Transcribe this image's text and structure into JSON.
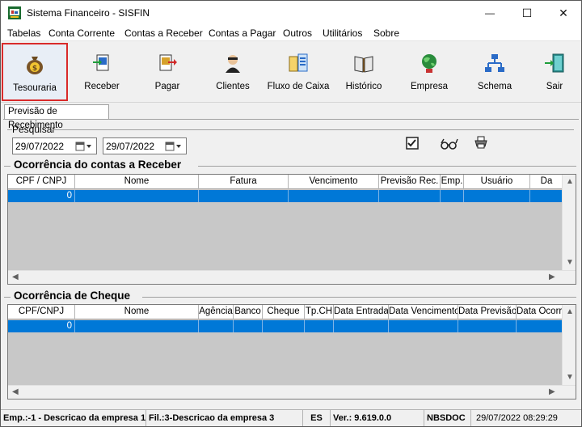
{
  "window": {
    "title": "Sistema Financeiro - SISFIN",
    "controls": {
      "minimize": "—",
      "maximize": "☐",
      "close": "✕"
    }
  },
  "menu": [
    "Tabelas",
    "Conta Corrente",
    "Contas a Receber",
    "Contas a Pagar",
    "Outros",
    "Utilitários",
    "Sobre"
  ],
  "toolbar": {
    "buttons": [
      {
        "label": "Tesouraria",
        "icon": "money-bag-icon",
        "active": true
      },
      {
        "label": "Receber",
        "icon": "receive-document-icon",
        "active": false
      },
      {
        "label": "Pagar",
        "icon": "pay-document-icon",
        "active": false
      },
      {
        "label": "Clientes",
        "icon": "clients-icon",
        "active": false
      },
      {
        "label": "Fluxo de Caixa",
        "icon": "cash-flow-icon",
        "active": false
      },
      {
        "label": "Histórico",
        "icon": "book-icon",
        "active": false
      },
      {
        "label": "Empresa",
        "icon": "company-globe-icon",
        "active": false
      },
      {
        "label": "Schema",
        "icon": "network-schema-icon",
        "active": false
      },
      {
        "label": "Sair",
        "icon": "exit-door-icon",
        "active": false
      }
    ]
  },
  "tab": {
    "label": "Previsão de Recebimento"
  },
  "filter": {
    "group_label": "Pesquisar",
    "date_from": "29/07/2022",
    "date_to": "29/07/2022",
    "actions": [
      "checklist-icon",
      "glasses-icon",
      "printer-icon"
    ]
  },
  "receivables": {
    "title": "Ocorrência do contas a Receber",
    "columns": [
      "CPF / CNPJ",
      "Nome",
      "Fatura",
      "Vencimento",
      "Previsão Rec.",
      "Emp.",
      "Usuário",
      "Da"
    ],
    "rows": [
      {
        "cpf_cnpj": "0"
      }
    ]
  },
  "cheques": {
    "title": "Ocorrência de Cheque",
    "columns": [
      "CPF/CNPJ",
      "Nome",
      "Agência",
      "Banco",
      "Cheque",
      "Tp.CH",
      "Data Entrada",
      "Data Vencimento",
      "Data Previsão",
      "Data Ocorrê"
    ],
    "rows": [
      {
        "cpf_cnpj": "0"
      }
    ]
  },
  "status": {
    "empresa": "Emp.:-1 - Descricao da empresa 1",
    "filial": "Fil.:3-Descricao da empresa 3",
    "uf": "ES",
    "versao": "Ver.: 9.619.0.0",
    "sistema": "NBSDOC",
    "datetime": "29/07/2022 08:29:29"
  },
  "colors": {
    "selection": "#0078d7",
    "active_border": "#d92a2a",
    "grid_empty": "#c8c8c8"
  }
}
